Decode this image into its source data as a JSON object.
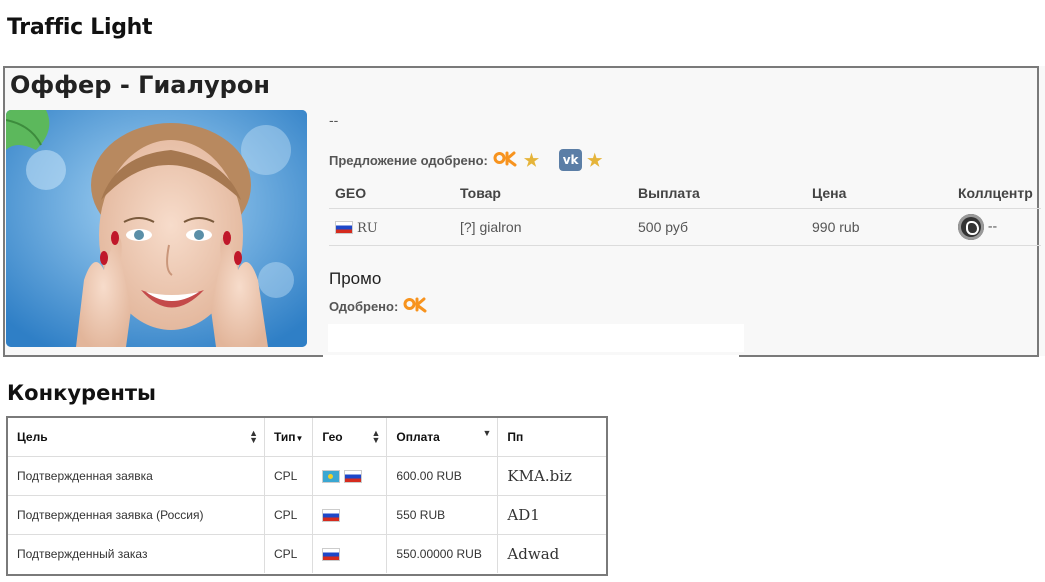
{
  "page": {
    "title": "Traffic Light"
  },
  "offer": {
    "title": "Оффер - Гиалурон",
    "description": "--",
    "approved_label": "Предложение одобрено:",
    "approved_sources": [
      "ok-icon",
      "star-icon",
      "vk-icon",
      "star-icon"
    ],
    "vk_letters": "vk",
    "table": {
      "headers": [
        "GEO",
        "Товар",
        "Выплата",
        "Цена",
        "Коллцентр"
      ],
      "rows": [
        {
          "geo": "RU",
          "product": "[?] gialron",
          "payout": "500 руб",
          "price": "990 rub",
          "callcenter": "--"
        }
      ]
    },
    "promo_title": "Промо",
    "promo_approved_label": "Одобрено:"
  },
  "competitors": {
    "title": "Конкуренты",
    "headers": [
      "Цель",
      "Тип",
      "Гео",
      "Оплата",
      "Пп"
    ],
    "rows": [
      {
        "goal": "Подтвержденная заявка",
        "type": "CPL",
        "geo": [
          "KZ",
          "RU"
        ],
        "payment": "600.00 RUB",
        "pp": "KMA.biz"
      },
      {
        "goal": "Подтвержденная заявка (Россия)",
        "type": "CPL",
        "geo": [
          "RU"
        ],
        "payment": "550 RUB",
        "pp": "AD1"
      },
      {
        "goal": "Подтвержденный заказ",
        "type": "CPL",
        "geo": [
          "RU"
        ],
        "payment": "550.00000 RUB",
        "pp": "Adwad"
      }
    ]
  },
  "colors": {
    "ok_orange": "#f7931e",
    "vk_blue": "#5b7ea6",
    "star_gold": "#e5b43a",
    "border_gray": "#7a7a7a"
  }
}
